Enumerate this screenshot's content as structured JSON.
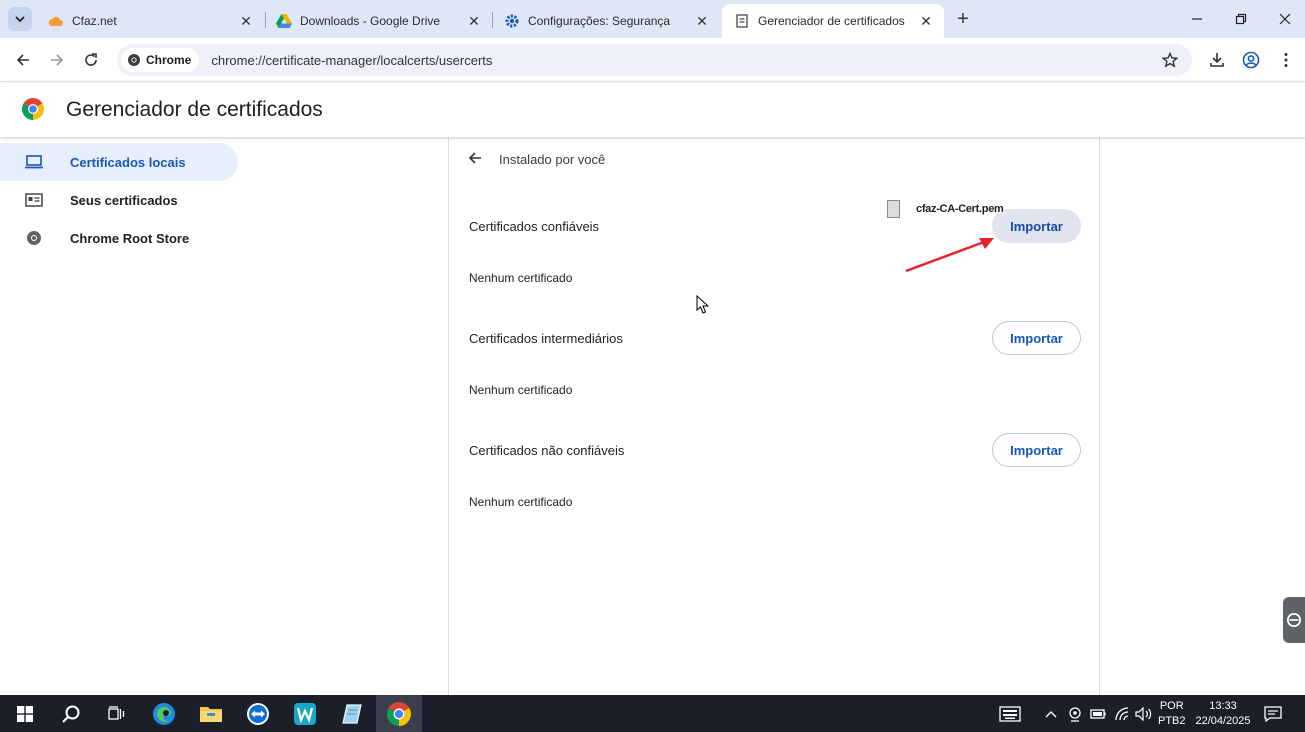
{
  "tabs": [
    {
      "title": "Cfaz.net",
      "icon": "cloud-icon",
      "active": false
    },
    {
      "title": "Downloads - Google Drive",
      "icon": "google-drive-icon",
      "active": false
    },
    {
      "title": "Configurações: Segurança",
      "icon": "gear-icon",
      "active": false
    },
    {
      "title": "Gerenciador de certificados",
      "icon": "document-icon",
      "active": true
    }
  ],
  "toolbar": {
    "chip_label": "Chrome",
    "url": "chrome://certificate-manager/localcerts/usercerts"
  },
  "page": {
    "title": "Gerenciador de certificados"
  },
  "sidebar": {
    "items": [
      {
        "label": "Certificados locais",
        "icon": "laptop-icon",
        "selected": true
      },
      {
        "label": "Seus certificados",
        "icon": "id-card-icon",
        "selected": false
      },
      {
        "label": "Chrome Root Store",
        "icon": "chrome-icon",
        "selected": false
      }
    ]
  },
  "main": {
    "subheader": "Instalado por você",
    "sections": [
      {
        "title": "Certificados confiáveis",
        "button": "Importar",
        "empty_text": "Nenhum certificado"
      },
      {
        "title": "Certificados intermediários",
        "button": "Importar",
        "empty_text": "Nenhum certificado"
      },
      {
        "title": "Certificados não confiáveis",
        "button": "Importar",
        "empty_text": "Nenhum certificado"
      }
    ]
  },
  "drag": {
    "filename": "cfaz-CA-Cert.pem"
  },
  "taskbar": {
    "language_line1": "POR",
    "language_line2": "PTB2",
    "time": "13:33",
    "date": "22/04/2025"
  },
  "colors": {
    "accent": "#1a57b5",
    "tabstrip": "#dfe7f7",
    "selected_nav": "#e7eefc",
    "annotation_arrow": "#e8202a",
    "taskbar": "#1b1f2a"
  }
}
